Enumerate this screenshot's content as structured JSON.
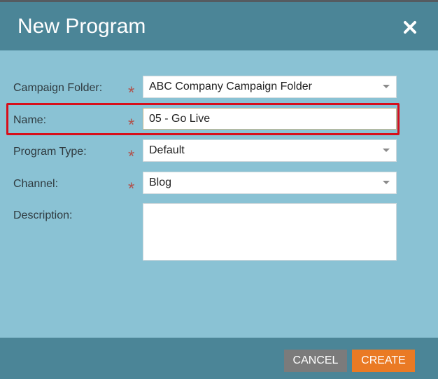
{
  "dialog": {
    "title": "New Program"
  },
  "form": {
    "campaign_folder": {
      "label": "Campaign Folder:",
      "value": "ABC Company Campaign Folder",
      "required": true
    },
    "name": {
      "label": "Name:",
      "value": "05 - Go Live",
      "required": true
    },
    "program_type": {
      "label": "Program Type:",
      "value": "Default",
      "required": true
    },
    "channel": {
      "label": "Channel:",
      "value": "Blog",
      "required": true
    },
    "description": {
      "label": "Description:",
      "value": ""
    },
    "required_marker": "*"
  },
  "footer": {
    "cancel_label": "CANCEL",
    "create_label": "CREATE"
  },
  "colors": {
    "header": "#4b8597",
    "body": "#8ac2d4",
    "highlight": "#d70e1a",
    "cancel": "#7b7b7b",
    "create": "#ea7a24"
  }
}
